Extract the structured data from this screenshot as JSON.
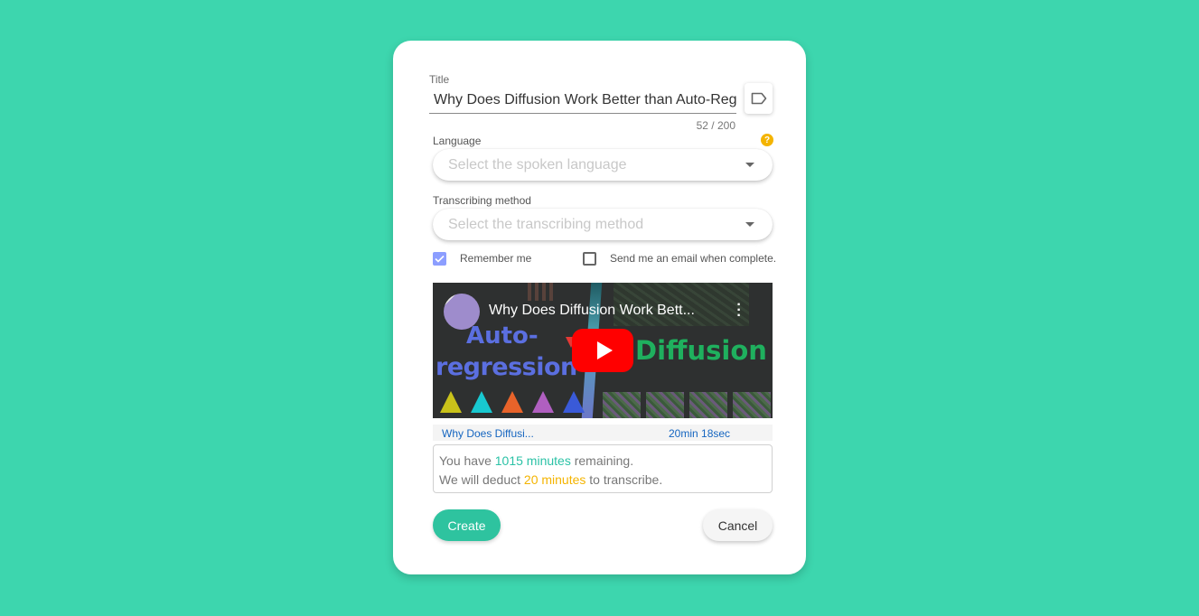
{
  "form": {
    "title_label": "Title",
    "title_value": "Why Does Diffusion Work Better than Auto-Regression?",
    "title_counter": "52 / 200",
    "tag_icon": "label-tag-icon",
    "language_label": "Language",
    "language_placeholder": "Select the spoken language",
    "help_icon_glyph": "?",
    "method_label": "Transcribing method",
    "method_placeholder": "Select the transcribing method",
    "remember_label": "Remember me",
    "remember_checked": true,
    "email_label": "Send me an email when complete.",
    "email_checked": false
  },
  "video": {
    "overlay_title": "Why Does Diffusion Work Bett...",
    "thumb_text_left_1": "Auto-",
    "thumb_text_left_2": "regression",
    "thumb_text_right": "Diffusion",
    "kebab_glyph": "⋮",
    "short_title": "Why Does Diffusi...",
    "duration": "20min 18sec",
    "tree_colors": [
      "#c9c21a",
      "#18c8d0",
      "#e8632a",
      "#b05fc0",
      "#3a5ad8"
    ]
  },
  "quota": {
    "line1_prefix": "You have ",
    "remaining": "1015 minutes",
    "line1_suffix": " remaining.",
    "line2_prefix": "We will deduct ",
    "deduct": "20 minutes",
    "line2_suffix": " to transcribe."
  },
  "actions": {
    "create_label": "Create",
    "cancel_label": "Cancel"
  },
  "colors": {
    "background": "#3dd6ae",
    "primary": "#2ec39f",
    "checkbox": "#8c9eff",
    "highlight_green": "#2bc2a6",
    "highlight_orange": "#f4b400",
    "link_blue": "#1565c0"
  }
}
